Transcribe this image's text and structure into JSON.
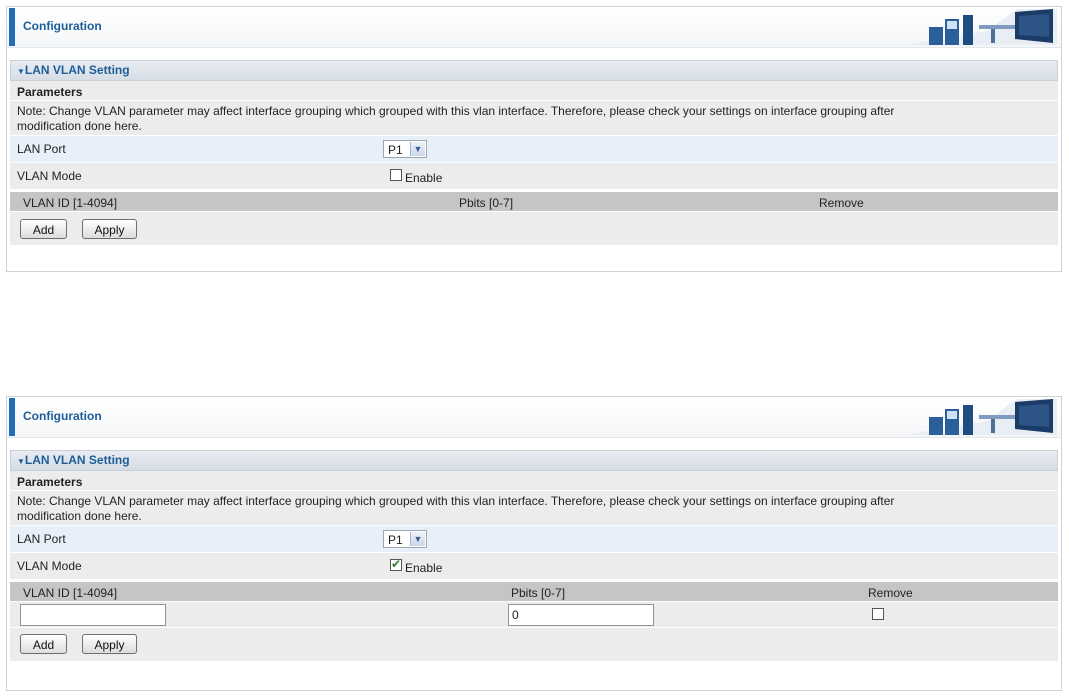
{
  "panels": [
    {
      "config_title": "Configuration",
      "section_title": "LAN VLAN Setting",
      "params_label": "Parameters",
      "note_line1": "Note: Change VLAN parameter may affect interface grouping which grouped with this vlan interface. Therefore, please check your settings on interface grouping after",
      "note_line2": "modification done here.",
      "lan_port_label": "LAN Port",
      "lan_port_value": "P1",
      "vlan_mode_label": "VLAN Mode",
      "enable_label": "Enable",
      "enable_checked": false,
      "col_vlan_id": "VLAN ID [1-4094]",
      "col_pbits": "Pbits [0-7]",
      "col_remove": "Remove",
      "add_label": "Add",
      "apply_label": "Apply"
    },
    {
      "config_title": "Configuration",
      "section_title": "LAN VLAN Setting",
      "params_label": "Parameters",
      "note_line1": "Note: Change VLAN parameter may affect interface grouping which grouped with this vlan interface. Therefore, please check your settings on interface grouping after",
      "note_line2": "modification done here.",
      "lan_port_label": "LAN Port",
      "lan_port_value": "P1",
      "vlan_mode_label": "VLAN Mode",
      "enable_label": "Enable",
      "enable_checked": true,
      "col_vlan_id": "VLAN ID [1-4094]",
      "col_pbits": "Pbits [0-7]",
      "col_remove": "Remove",
      "vlan_id_value": "",
      "pbits_value": "0",
      "add_label": "Add",
      "apply_label": "Apply"
    }
  ],
  "icons": {
    "section_caret": "triangle-down-icon",
    "select_arrow": "chevron-down-icon",
    "header_art": "network-banner-image"
  },
  "colors": {
    "accent": "#1f6fb7",
    "title_text": "#1c5d99",
    "table_header": "#c5c5c5",
    "row_grey": "#ececec",
    "row_blue": "#e7f0f8"
  }
}
